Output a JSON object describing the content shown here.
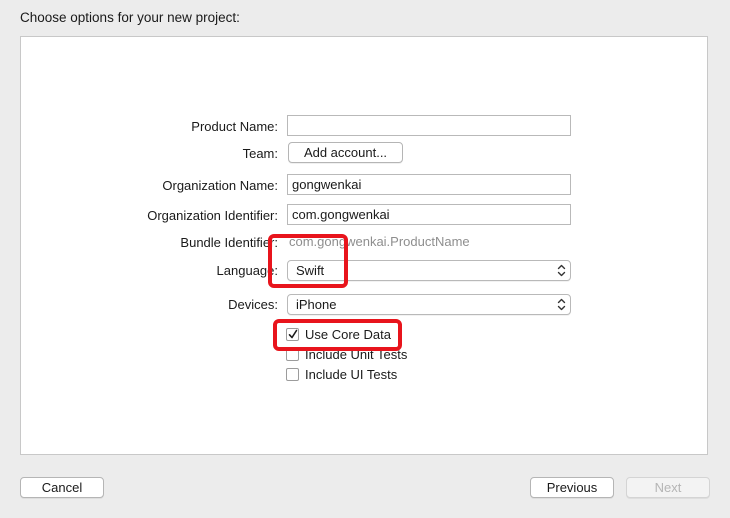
{
  "heading": "Choose options for your new project:",
  "form": {
    "product_name": {
      "label": "Product Name:",
      "value": ""
    },
    "team": {
      "label": "Team:",
      "button": "Add account..."
    },
    "org_name": {
      "label": "Organization Name:",
      "value": "gongwenkai"
    },
    "org_identifier": {
      "label": "Organization Identifier:",
      "value": "com.gongwenkai"
    },
    "bundle_identifier": {
      "label": "Bundle Identifier:",
      "value": "com.gongwenkai.ProductName"
    },
    "language": {
      "label": "Language:",
      "selected": "Swift"
    },
    "devices": {
      "label": "Devices:",
      "selected": "iPhone"
    },
    "options": [
      {
        "label": "Use Core Data",
        "checked": true
      },
      {
        "label": "Include Unit Tests",
        "checked": false
      },
      {
        "label": "Include UI Tests",
        "checked": false
      }
    ]
  },
  "footer": {
    "cancel": "Cancel",
    "previous": "Previous",
    "next": "Next"
  },
  "colors": {
    "highlight": "#e8141c",
    "panel_background": "#ffffff",
    "window_background": "#ececec"
  },
  "icons": {
    "dropdown": "chevron-up-down-icon",
    "check": "checkmark-icon"
  }
}
